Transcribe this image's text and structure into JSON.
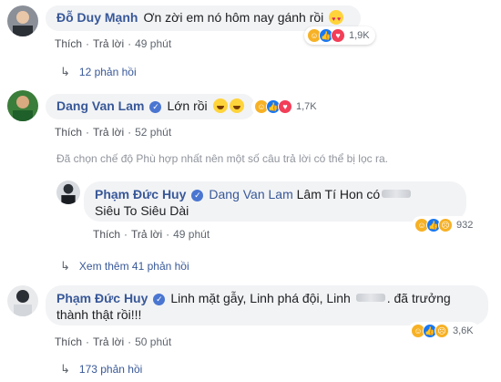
{
  "comments": [
    {
      "author": "Đỗ Duy Mạnh",
      "text": "Ơn zời em nó hôm nay gánh rồi",
      "reaction_count": "1,9K",
      "like_label": "Thích",
      "reply_label": "Trả lời",
      "time": "49 phút",
      "replies_label": "12 phản hồi"
    },
    {
      "author": "Dang Van Lam",
      "text": "Lớn rồi",
      "reaction_count": "1,7K",
      "like_label": "Thích",
      "reply_label": "Trả lời",
      "time": "52 phút",
      "filter_note": "Đã chọn chế độ Phù hợp nhất nên một số câu trả lời có thể bị lọc ra."
    },
    {
      "author": "Phạm Đức Huy",
      "mention": "Dang Van Lam",
      "text_line1": "Lâm Tí Hon có",
      "text_line2": "Siêu To Siêu Dài",
      "reaction_count": "932",
      "like_label": "Thích",
      "reply_label": "Trả lời",
      "time": "49 phút",
      "more_replies_label": "Xem thêm 41 phản hồi"
    },
    {
      "author": "Phạm Đức Huy",
      "text_part1": "Linh mặt gẫy, Linh phá đội, Linh",
      "text_part2": ". đã trưởng",
      "text_line2": "thành thật rồi!!!",
      "reaction_count": "3,6K",
      "like_label": "Thích",
      "reply_label": "Trả lời",
      "time": "50 phút",
      "replies_label": "173 phản hồi"
    }
  ],
  "icons": {
    "verified": "verified-badge-icon",
    "reply_arrow": "reply-arrow-icon"
  }
}
